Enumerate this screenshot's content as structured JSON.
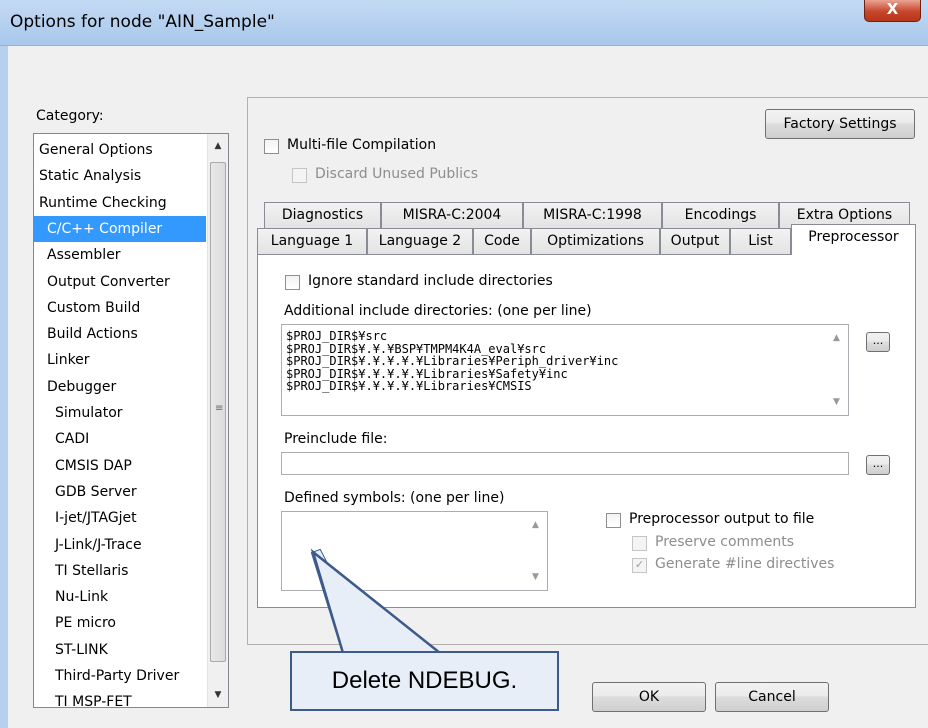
{
  "window": {
    "title": "Options for node \"AIN_Sample\"",
    "close_glyph": "X"
  },
  "category": {
    "label": "Category:",
    "items": [
      {
        "label": "General Options",
        "level": 0,
        "selected": false
      },
      {
        "label": "Static Analysis",
        "level": 0,
        "selected": false
      },
      {
        "label": "Runtime Checking",
        "level": 0,
        "selected": false
      },
      {
        "label": "C/C++ Compiler",
        "level": 1,
        "selected": true
      },
      {
        "label": "Assembler",
        "level": 1,
        "selected": false
      },
      {
        "label": "Output Converter",
        "level": 1,
        "selected": false
      },
      {
        "label": "Custom Build",
        "level": 1,
        "selected": false
      },
      {
        "label": "Build Actions",
        "level": 1,
        "selected": false
      },
      {
        "label": "Linker",
        "level": 1,
        "selected": false
      },
      {
        "label": "Debugger",
        "level": 1,
        "selected": false
      },
      {
        "label": "Simulator",
        "level": 2,
        "selected": false
      },
      {
        "label": "CADI",
        "level": 2,
        "selected": false
      },
      {
        "label": "CMSIS DAP",
        "level": 2,
        "selected": false
      },
      {
        "label": "GDB Server",
        "level": 2,
        "selected": false
      },
      {
        "label": "I-jet/JTAGjet",
        "level": 2,
        "selected": false
      },
      {
        "label": "J-Link/J-Trace",
        "level": 2,
        "selected": false
      },
      {
        "label": "TI Stellaris",
        "level": 2,
        "selected": false
      },
      {
        "label": "Nu-Link",
        "level": 2,
        "selected": false
      },
      {
        "label": "PE micro",
        "level": 2,
        "selected": false
      },
      {
        "label": "ST-LINK",
        "level": 2,
        "selected": false
      },
      {
        "label": "Third-Party Driver",
        "level": 2,
        "selected": false
      },
      {
        "label": "TI MSP-FET",
        "level": 2,
        "selected": false
      }
    ]
  },
  "compiler": {
    "factory_settings": "Factory Settings",
    "multi_file": {
      "label": "Multi-file Compilation",
      "checked": false
    },
    "discard_publics": {
      "label": "Discard Unused Publics",
      "checked": false,
      "enabled": false
    },
    "tabs_row1": [
      "Diagnostics",
      "MISRA-C:2004",
      "MISRA-C:1998",
      "Encodings",
      "Extra Options"
    ],
    "tabs_row2": [
      "Language 1",
      "Language 2",
      "Code",
      "Optimizations",
      "Output",
      "List",
      "Preprocessor"
    ],
    "active_tab": "Preprocessor"
  },
  "preprocessor": {
    "ignore_std": {
      "label": "Ignore standard include directories",
      "checked": false
    },
    "include_dirs_label": "Additional include directories: (one per line)",
    "include_dirs": "$PROJ_DIR$¥src\n$PROJ_DIR$¥.¥.¥BSP¥TMPM4K4A_eval¥src\n$PROJ_DIR$¥.¥.¥.¥.¥Libraries¥Periph_driver¥inc\n$PROJ_DIR$¥.¥.¥.¥.¥Libraries¥Safety¥inc\n$PROJ_DIR$¥.¥.¥.¥.¥Libraries¥CMSIS",
    "browse_label": "...",
    "preinclude_label": "Preinclude file:",
    "preinclude_value": "",
    "defined_label": "Defined symbols: (one per line)",
    "defined_value": "",
    "pp_output": {
      "label": "Preprocessor output to file",
      "checked": false
    },
    "preserve_comments": {
      "label": "Preserve comments",
      "checked": false,
      "enabled": false
    },
    "line_directives": {
      "label": "Generate #line directives",
      "checked": true,
      "enabled": false
    }
  },
  "buttons": {
    "ok": "OK",
    "cancel": "Cancel"
  },
  "callout": {
    "text": "Delete NDEBUG.",
    "fill": "#e8eef8",
    "stroke": "#3c5a8a"
  },
  "colors": {
    "selection": "#3399ff",
    "title_bar": "#b7d0ee",
    "close_button": "#c7452c"
  }
}
